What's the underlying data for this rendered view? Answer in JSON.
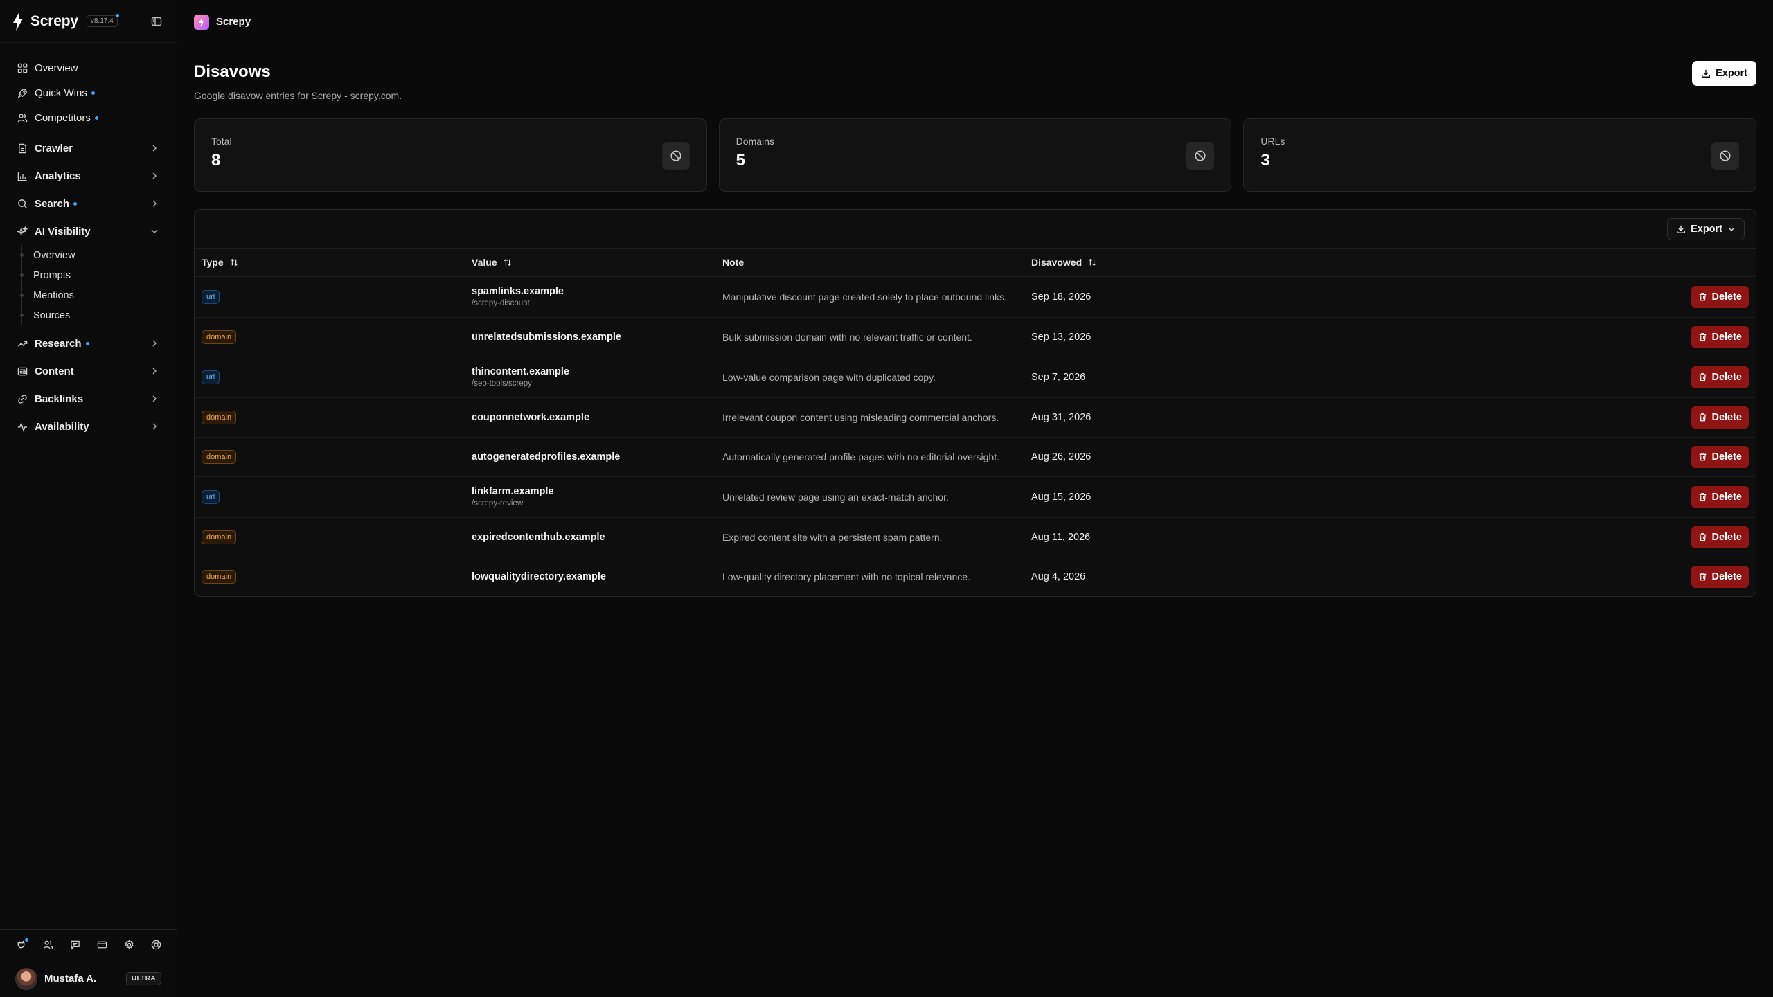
{
  "app": {
    "name": "Screpy",
    "version": "v8.17.4"
  },
  "sidebar": {
    "nav": [
      {
        "label": "Overview",
        "dot": false,
        "chevron": null
      },
      {
        "label": "Quick Wins",
        "dot": true,
        "chevron": null
      },
      {
        "label": "Competitors",
        "dot": true,
        "chevron": null
      }
    ],
    "groups": [
      {
        "label": "Crawler",
        "dot": false,
        "expanded": false
      },
      {
        "label": "Analytics",
        "dot": false,
        "expanded": false
      },
      {
        "label": "Search",
        "dot": true,
        "expanded": false
      },
      {
        "label": "AI Visibility",
        "dot": false,
        "expanded": true
      },
      {
        "label": "Research",
        "dot": true,
        "expanded": false
      },
      {
        "label": "Content",
        "dot": false,
        "expanded": false
      },
      {
        "label": "Backlinks",
        "dot": false,
        "expanded": false
      },
      {
        "label": "Availability",
        "dot": false,
        "expanded": false
      }
    ],
    "ai_visibility_items": [
      "Overview",
      "Prompts",
      "Mentions",
      "Sources"
    ],
    "user": {
      "name": "Mustafa A.",
      "plan": "ULTRA"
    }
  },
  "topbar": {
    "project": "Screpy"
  },
  "page": {
    "title": "Disavows",
    "subtitle": "Google disavow entries for Screpy - screpy.com.",
    "export_label": "Export"
  },
  "stats": [
    {
      "label": "Total",
      "value": "8"
    },
    {
      "label": "Domains",
      "value": "5"
    },
    {
      "label": "URLs",
      "value": "3"
    }
  ],
  "table": {
    "export_label": "Export",
    "headers": {
      "type": "Type",
      "value": "Value",
      "note": "Note",
      "disavowed": "Disavowed"
    },
    "delete_label": "Delete",
    "rows": [
      {
        "type": "url",
        "value": "spamlinks.example",
        "path": "/screpy-discount",
        "note": "Manipulative discount page created solely to place outbound links.",
        "date": "Sep 18, 2026"
      },
      {
        "type": "domain",
        "value": "unrelatedsubmissions.example",
        "path": "",
        "note": "Bulk submission domain with no relevant traffic or content.",
        "date": "Sep 13, 2026"
      },
      {
        "type": "url",
        "value": "thincontent.example",
        "path": "/seo-tools/screpy",
        "note": "Low-value comparison page with duplicated copy.",
        "date": "Sep 7, 2026"
      },
      {
        "type": "domain",
        "value": "couponnetwork.example",
        "path": "",
        "note": "Irrelevant coupon content using misleading commercial anchors.",
        "date": "Aug 31, 2026"
      },
      {
        "type": "domain",
        "value": "autogeneratedprofiles.example",
        "path": "",
        "note": "Automatically generated profile pages with no editorial oversight.",
        "date": "Aug 26, 2026"
      },
      {
        "type": "url",
        "value": "linkfarm.example",
        "path": "/screpy-review",
        "note": "Unrelated review page using an exact-match anchor.",
        "date": "Aug 15, 2026"
      },
      {
        "type": "domain",
        "value": "expiredcontenthub.example",
        "path": "",
        "note": "Expired content site with a persistent spam pattern.",
        "date": "Aug 11, 2026"
      },
      {
        "type": "domain",
        "value": "lowqualitydirectory.example",
        "path": "",
        "note": "Low-quality directory placement with no topical relevance.",
        "date": "Aug 4, 2026"
      }
    ]
  },
  "colors": {
    "accent_dot": "#3ba6ff",
    "delete": "#8f1414",
    "url_badge": "#6cb8ff",
    "domain_badge": "#f3a54a"
  }
}
